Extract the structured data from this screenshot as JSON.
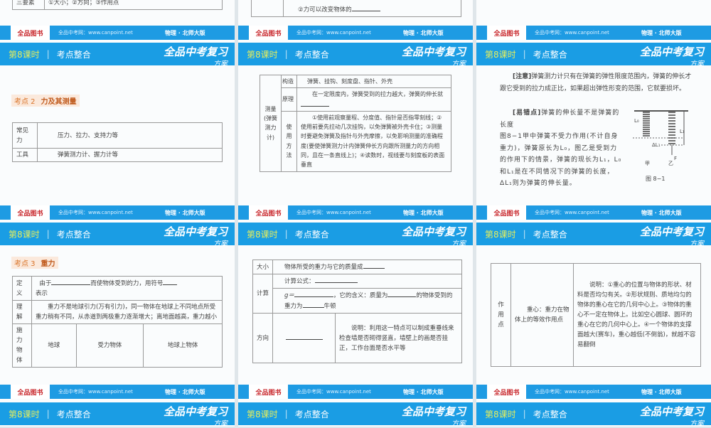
{
  "header": {
    "lesson": "第8课时",
    "sep": "|",
    "section": "考点整合",
    "brand": "全品中考复习",
    "brand_sub": "方案"
  },
  "footer": {
    "logo": "全品图书",
    "site": "全品中考网：www.canpoint.net",
    "subject": "物理 · 北师大版"
  },
  "top": {
    "c1_label": "三要素",
    "c1_value": "①大小；②方向；③作用点",
    "c2_value": "②力可以改变物体的"
  },
  "s1": {
    "tag": "考点 2",
    "title": "力及其测量",
    "rows": [
      [
        "常见力",
        "压力、拉力、支持力等"
      ],
      [
        "工具",
        "弹簧测力计、握力计等"
      ]
    ]
  },
  "s2": {
    "group": "测量(弹簧测力计)",
    "rows": [
      [
        "构造",
        "弹簧、挂钩、刻度盘、指针、外壳"
      ],
      [
        "原理",
        "在一定限度内，弹簧受到的拉力越大，弹簧的伸长就"
      ],
      [
        "使用方法",
        "①使用前观察量程、分度值、指针是否指零刻线；②使用前要先拉动几次挂钩，以免弹簧被外壳卡住；③测量时要避免弹簧及指针与外壳摩擦，以免影响测量的准确程度(要使弹簧测力计内弹簧伸长方向跟所测量力的方向相同，且在一条直线上)；④读数时，视线要与刻度板的表面垂直"
      ]
    ]
  },
  "s3": {
    "note_label": "[注意]",
    "note": "弹簧测力计只有在弹簧的弹性限度范围内，弹簧的伸长才跟它受到的拉力成正比，如果超出弹性形变的范围，它就要损坏。",
    "err_label": "[易错点]",
    "err": "弹簧的伸长量不是弹簧的长度",
    "para": "图8−1甲中弹簧不受力作用(不计自身重力)，弹簧原长为L₀，图乙是受到力的作用下的情景，弹簧的现长为L₁，L₀和L₁是在不同情况下的弹簧的长度，ΔL₁则为弹簧的伸长量。",
    "fig": {
      "l0": "L₀",
      "l1": "L₁",
      "dl": "ΔL₁",
      "f": "F",
      "a": "甲",
      "b": "乙",
      "caption": "图 8−1"
    }
  },
  "s4": {
    "tag": "考点 3",
    "title": "重力",
    "def_label": "定义",
    "def_a": "由于",
    "def_b": "而使物体受到的力，用符号",
    "def_c": "表示",
    "und_label": "理解",
    "und": "重力不是地球引力(万有引力)，同一物体在地球上不同地点所受重力稍有不同，从赤道到两极重力逐渐增大；离地面越高，重力越小",
    "src_label": "施力物体",
    "src": [
      "地球",
      "受力物体",
      "地球上物体"
    ]
  },
  "s5": {
    "size_label": "大小",
    "size": "物体所受的重力与它的质量成",
    "calc_label": "计算",
    "formula": "计算公式：",
    "g_a": "g＝",
    "g_b": "，它的含义：质量为",
    "g_c": "的物体受到的重力为",
    "g_d": "牛顿",
    "dir_label": "方向",
    "dir_note": "说明：利用这一特点可以制成重垂线来检查墙是否砌得竖直，墙壁上的画是否挂正，工作台面是否水平等"
  },
  "s6": {
    "label": "作用点",
    "center": "重心：重力在物体上的等效作用点",
    "note": "说明：①重心的位置与物体的形状、材料是否均匀有关。②形状规则、质地均匀的物体的重心在它的几何中心上。③物体的重心不一定在物体上。比如空心圆球、圆环的重心在它的几何中心上。④一个物体的支撑面越大(赛车)，重心越低(不倒翁)，就越不容易翻倒"
  }
}
